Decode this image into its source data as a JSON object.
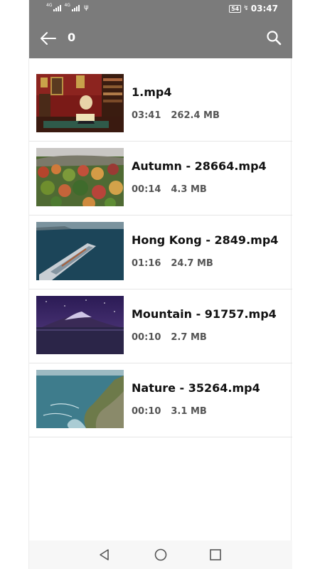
{
  "status_bar": {
    "signal_1_label": "4G",
    "signal_2_label": "4G",
    "usb_icon": "usb-icon",
    "battery_level": "54",
    "time": "03:47"
  },
  "app_bar": {
    "title": "0",
    "back_icon": "arrow-left-icon",
    "search_icon": "search-icon"
  },
  "videos": [
    {
      "name": "1.mp4",
      "duration": "03:41",
      "size": "262.4 MB",
      "thumbnail": "library-reader"
    },
    {
      "name": "Autumn - 28664.mp4",
      "duration": "00:14",
      "size": "4.3 MB",
      "thumbnail": "autumn-forest"
    },
    {
      "name": "Hong Kong - 2849.mp4",
      "duration": "01:16",
      "size": "24.7 MB",
      "thumbnail": "cruise-ship"
    },
    {
      "name": "Mountain - 91757.mp4",
      "duration": "00:10",
      "size": "2.7 MB",
      "thumbnail": "night-mountain"
    },
    {
      "name": "Nature - 35264.mp4",
      "duration": "00:10",
      "size": "3.1 MB",
      "thumbnail": "coastline"
    }
  ],
  "nav_bar": {
    "back_icon": "triangle-back-icon",
    "home_icon": "circle-home-icon",
    "recents_icon": "square-recents-icon"
  },
  "colors": {
    "app_bar": "#7b7b7b",
    "title_text": "#111111",
    "meta_text": "#555555",
    "divider": "#e6e6e6"
  }
}
